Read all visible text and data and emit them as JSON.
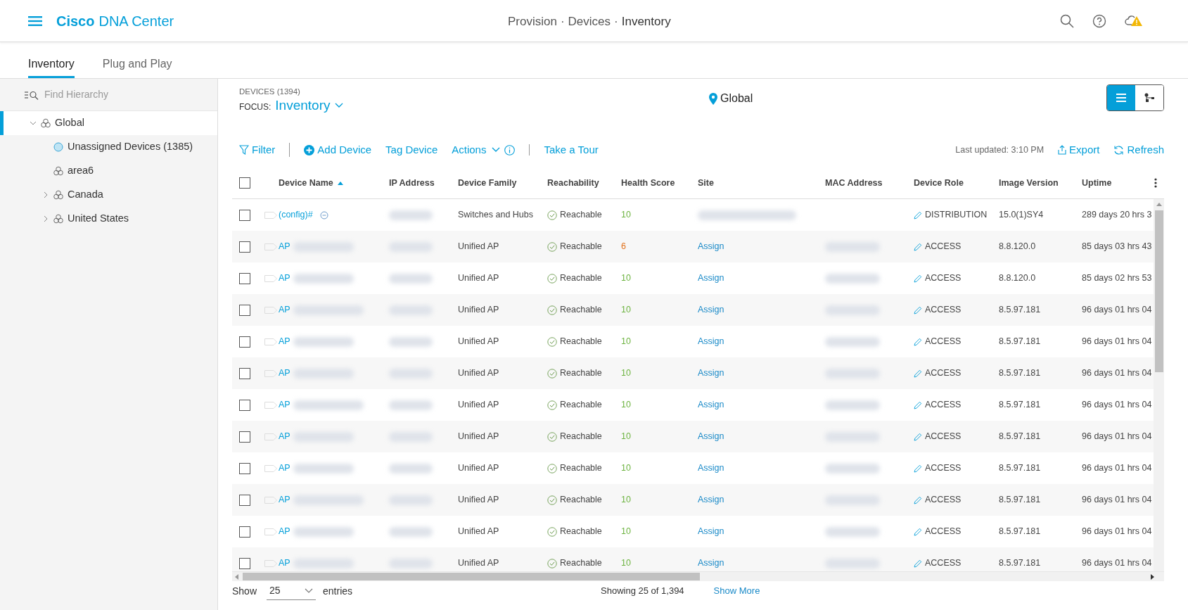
{
  "header": {
    "brand_bold": "Cisco",
    "brand": "DNA Center",
    "breadcrumb": [
      "Provision",
      "Devices",
      "Inventory"
    ],
    "separator": "·"
  },
  "tabs": [
    {
      "label": "Inventory",
      "selected": true
    },
    {
      "label": "Plug and Play",
      "selected": false
    }
  ],
  "sidebar": {
    "search": {
      "placeholder": "Find Hierarchy"
    },
    "tree": [
      {
        "label": "Global",
        "kind": "site",
        "expanded": true,
        "selected": true,
        "children": [
          {
            "label": "Unassigned Devices (1385)",
            "kind": "unassigned",
            "selected": false
          },
          {
            "label": "area6",
            "kind": "site",
            "selected": false
          },
          {
            "label": "Canada",
            "kind": "site",
            "expanded": false,
            "selected": false
          },
          {
            "label": "United States",
            "kind": "site",
            "expanded": false,
            "selected": false
          }
        ]
      }
    ]
  },
  "devices": {
    "title": "DEVICES (1394)",
    "focus_label": "FOCUS:",
    "focus_value": "Inventory",
    "location": "Global",
    "view_toggle": [
      {
        "kind": "list",
        "selected": true
      },
      {
        "kind": "topology",
        "selected": false
      }
    ],
    "toolbar": {
      "filter": "Filter",
      "add": "Add Device",
      "tag": "Tag Device",
      "actions": "Actions",
      "tour": "Take a Tour",
      "last_updated": "Last updated: 3:10 PM",
      "export": "Export",
      "refresh": "Refresh"
    },
    "table": {
      "select_all": {
        "checked": false
      },
      "columns": [
        "Device Name",
        "IP Address",
        "Device Family",
        "Reachability",
        "Health Score",
        "Site",
        "MAC Address",
        "Device Role",
        "Image Version",
        "Uptime"
      ],
      "rows": [
        {
          "kind": "config",
          "checked": false,
          "name": "(config)#",
          "family": "Switches and Hubs",
          "reachability": "Reachable",
          "health": {
            "value": "10",
            "color": "#6cb33f"
          },
          "role": "DISTRIBUTION",
          "image": "15.0(1)SY4",
          "uptime": "289 days 20 hrs 3"
        },
        {
          "kind": "ap",
          "checked": false,
          "name": "AP",
          "family": "Unified AP",
          "reachability": "Reachable",
          "health": {
            "value": "6",
            "color": "#e2731e"
          },
          "site": "Assign",
          "role": "ACCESS",
          "image": "8.8.120.0",
          "uptime": "85 days 03 hrs 43"
        },
        {
          "kind": "ap",
          "checked": false,
          "name": "AP",
          "family": "Unified AP",
          "reachability": "Reachable",
          "health": {
            "value": "10",
            "color": "#6cb33f"
          },
          "site": "Assign",
          "role": "ACCESS",
          "image": "8.8.120.0",
          "uptime": "85 days 02 hrs 53"
        },
        {
          "kind": "ap",
          "checked": false,
          "name": "AP",
          "family": "Unified AP",
          "reachability": "Reachable",
          "health": {
            "value": "10",
            "color": "#6cb33f"
          },
          "site": "Assign",
          "role": "ACCESS",
          "image": "8.5.97.181",
          "uptime": "96 days 01 hrs 04"
        },
        {
          "kind": "ap",
          "checked": false,
          "name": "AP",
          "family": "Unified AP",
          "reachability": "Reachable",
          "health": {
            "value": "10",
            "color": "#6cb33f"
          },
          "site": "Assign",
          "role": "ACCESS",
          "image": "8.5.97.181",
          "uptime": "96 days 01 hrs 04"
        },
        {
          "kind": "ap",
          "checked": false,
          "name": "AP",
          "family": "Unified AP",
          "reachability": "Reachable",
          "health": {
            "value": "10",
            "color": "#6cb33f"
          },
          "site": "Assign",
          "role": "ACCESS",
          "image": "8.5.97.181",
          "uptime": "96 days 01 hrs 04"
        },
        {
          "kind": "ap",
          "checked": false,
          "name": "AP",
          "family": "Unified AP",
          "reachability": "Reachable",
          "health": {
            "value": "10",
            "color": "#6cb33f"
          },
          "site": "Assign",
          "role": "ACCESS",
          "image": "8.5.97.181",
          "uptime": "96 days 01 hrs 04"
        },
        {
          "kind": "ap",
          "checked": false,
          "name": "AP",
          "family": "Unified AP",
          "reachability": "Reachable",
          "health": {
            "value": "10",
            "color": "#6cb33f"
          },
          "site": "Assign",
          "role": "ACCESS",
          "image": "8.5.97.181",
          "uptime": "96 days 01 hrs 04"
        },
        {
          "kind": "ap",
          "checked": false,
          "name": "AP",
          "family": "Unified AP",
          "reachability": "Reachable",
          "health": {
            "value": "10",
            "color": "#6cb33f"
          },
          "site": "Assign",
          "role": "ACCESS",
          "image": "8.5.97.181",
          "uptime": "96 days 01 hrs 04"
        },
        {
          "kind": "ap",
          "checked": false,
          "name": "AP",
          "family": "Unified AP",
          "reachability": "Reachable",
          "health": {
            "value": "10",
            "color": "#6cb33f"
          },
          "site": "Assign",
          "role": "ACCESS",
          "image": "8.5.97.181",
          "uptime": "96 days 01 hrs 04"
        },
        {
          "kind": "ap",
          "checked": false,
          "name": "AP",
          "family": "Unified AP",
          "reachability": "Reachable",
          "health": {
            "value": "10",
            "color": "#6cb33f"
          },
          "site": "Assign",
          "role": "ACCESS",
          "image": "8.5.97.181",
          "uptime": "96 days 01 hrs 04"
        },
        {
          "kind": "ap",
          "checked": false,
          "name": "AP",
          "family": "Unified AP",
          "reachability": "Reachable",
          "health": {
            "value": "10",
            "color": "#6cb33f"
          },
          "site": "Assign",
          "role": "ACCESS",
          "image": "8.5.97.181",
          "uptime": "96 days 01 hrs 04"
        }
      ]
    },
    "footer": {
      "show": "Show",
      "page_size": "25",
      "entries": "entries",
      "showing": "Showing 25 of 1,394",
      "more": "Show More"
    }
  }
}
